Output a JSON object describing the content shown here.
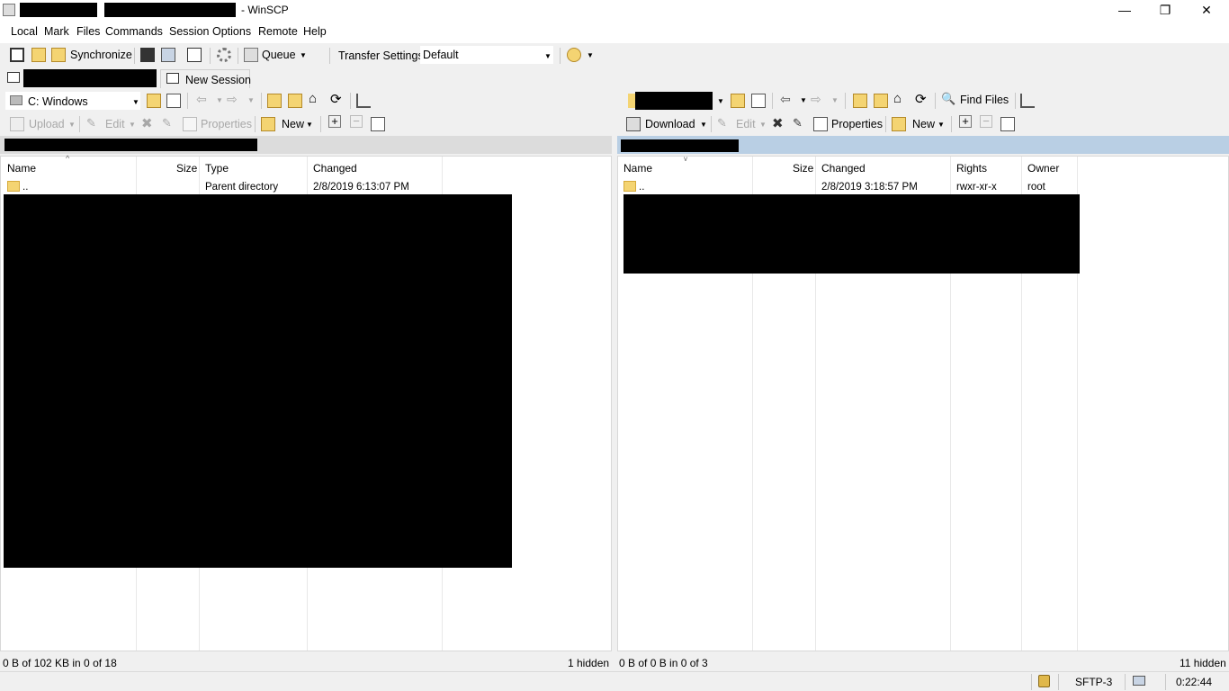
{
  "window": {
    "title": "- WinSCP",
    "min_label": "—",
    "restore_label": "❐",
    "close_label": "✕"
  },
  "menu": [
    "Local",
    "Mark",
    "Files",
    "Commands",
    "Session",
    "Options",
    "Remote",
    "Help"
  ],
  "toolbar": {
    "synchronize": "Synchronize",
    "queue": "Queue",
    "transfer_settings": "Transfer Settings",
    "transfer_default": "Default",
    "new_session": "New Session"
  },
  "local": {
    "drive": "C: Windows",
    "upload": "Upload",
    "edit": "Edit",
    "properties": "Properties",
    "new": "New",
    "columns": [
      "Name",
      "Size",
      "Type",
      "Changed"
    ],
    "row": {
      "name": "..",
      "type": "Parent directory",
      "changed": "2/8/2019  6:13:07 PM"
    },
    "status": "0 B of 102 KB in 0 of 18",
    "hidden": "1 hidden"
  },
  "remote": {
    "download": "Download",
    "edit": "Edit",
    "properties": "Properties",
    "new": "New",
    "find_files": "Find Files",
    "columns": [
      "Name",
      "Size",
      "Changed",
      "Rights",
      "Owner"
    ],
    "row": {
      "name": "..",
      "changed": "2/8/2019 3:18:57 PM",
      "rights": "rwxr-xr-x",
      "owner": "root"
    },
    "status": "0 B of 0 B in 0 of 3",
    "hidden": "11 hidden"
  },
  "statusbar": {
    "protocol": "SFTP-3",
    "time": "0:22:44"
  },
  "colors": {
    "path_active": "#b9cfe4",
    "folder": "#f4d472",
    "redaction": "#000000"
  }
}
